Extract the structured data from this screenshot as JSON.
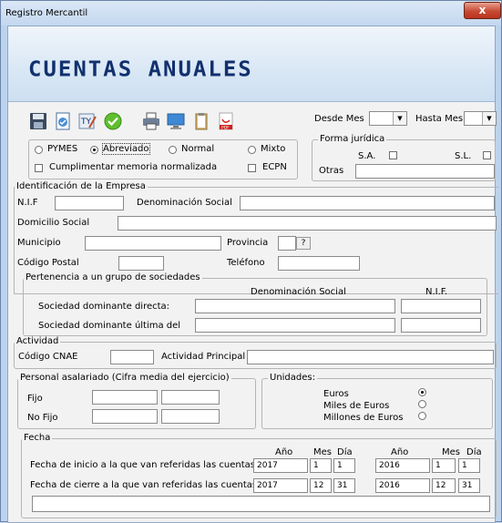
{
  "window": {
    "title": "Registro Mercantil",
    "close_glyph": "x"
  },
  "banner": {
    "title": "CUENTAS ANUALES"
  },
  "toolbar": {
    "icons": [
      "save-icon",
      "open-document-icon",
      "edit-text-icon",
      "ok-check-icon",
      "print-icon",
      "monitor-icon",
      "clipboard-icon",
      "pdf-icon"
    ],
    "desde_mes_label": "Desde Mes",
    "hasta_mes_label": "Hasta Mes",
    "desde_mes_value": "",
    "hasta_mes_value": ""
  },
  "modelo": {
    "pymes": "PYMES",
    "abreviado": "Abreviado",
    "normal": "Normal",
    "mixto": "Mixto",
    "selected": "Abreviado",
    "memoria": "Cumplimentar memoria normalizada",
    "ecpn": "ECPN"
  },
  "forma": {
    "legend": "Forma jurídica",
    "sa": "S.A.",
    "sl": "S.L.",
    "otras": "Otras",
    "otras_value": ""
  },
  "empresa": {
    "legend": "Identificación de la Empresa",
    "nif": "N.I.F",
    "denominacion": "Denominación Social",
    "domicilio": "Domicilio Social",
    "municipio": "Municipio",
    "provincia": "Provincia",
    "provincia_btn": "?",
    "cp": "Código Postal",
    "telefono": "Teléfono"
  },
  "grupo": {
    "legend": "Pertenencia a un grupo de sociedades",
    "col_denominacion": "Denominación Social",
    "col_nif": "N.I.F.",
    "directa": "Sociedad dominante directa:",
    "ultima": "Sociedad dominante última del"
  },
  "actividad": {
    "legend": "Actividad",
    "cnae": "Código CNAE",
    "principal": "Actividad Principal"
  },
  "personal": {
    "legend": "Personal asalariado (Cifra media del ejercicio)",
    "fijo": "Fijo",
    "no_fijo": "No Fijo"
  },
  "unidades": {
    "legend": "Unidades:",
    "euros": "Euros",
    "miles": "Miles de Euros",
    "millones": "Millones de Euros",
    "selected": "Euros"
  },
  "fecha": {
    "legend": "Fecha",
    "col_ano1": "Año",
    "col_mes1": "Mes",
    "col_dia1": "Día",
    "col_ano2": "Año",
    "col_mes2": "Mes",
    "col_dia2": "Día",
    "inicio_label": "Fecha de inicio a la que van referidas las cuentas:",
    "cierre_label": "Fecha de cierre a la que van referidas las cuentas:",
    "inicio": {
      "ano1": "2017",
      "mes1": "1",
      "dia1": "1",
      "ano2": "2016",
      "mes2": "1",
      "dia2": "1"
    },
    "cierre": {
      "ano1": "2017",
      "mes1": "12",
      "dia1": "31",
      "ano2": "2016",
      "mes2": "12",
      "dia2": "31"
    }
  }
}
